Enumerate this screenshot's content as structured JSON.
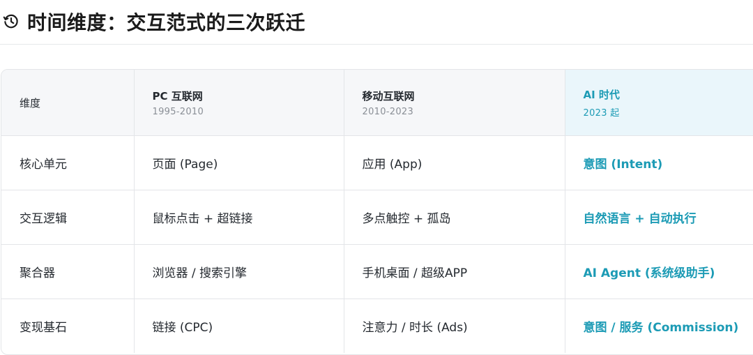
{
  "title": "时间维度：交互范式的三次跃迁",
  "icons": {
    "title_icon": "history-icon"
  },
  "colors": {
    "accent": "#1c9bb5",
    "header_bg": "#f6f7f9",
    "ai_header_bg": "#eaf6fb"
  },
  "table": {
    "headers": [
      {
        "label": "维度",
        "sub": ""
      },
      {
        "label": "PC 互联网",
        "sub": "1995-2010"
      },
      {
        "label": "移动互联网",
        "sub": "2010-2023"
      },
      {
        "label": "AI 时代",
        "sub": "2023 起"
      }
    ],
    "rows": [
      [
        "核心单元",
        "页面 (Page)",
        "应用 (App)",
        "意图 (Intent)"
      ],
      [
        "交互逻辑",
        "鼠标点击 + 超链接",
        "多点触控 + 孤岛",
        "自然语言 + 自动执行"
      ],
      [
        "聚合器",
        "浏览器 / 搜索引擎",
        "手机桌面 / 超级APP",
        "AI Agent (系统级助手)"
      ],
      [
        "变现基石",
        "链接 (CPC)",
        "注意力 / 时长 (Ads)",
        "意图 / 服务 (Commission)"
      ]
    ]
  }
}
